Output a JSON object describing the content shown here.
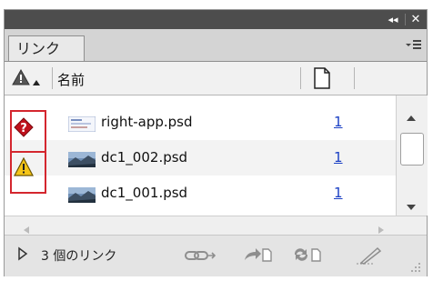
{
  "panel": {
    "tab_label": "リンク",
    "column_name_label": "名前",
    "status_text": "3 個のリンク"
  },
  "links": [
    {
      "name": "right-app.psd",
      "page": "1",
      "status": "missing",
      "thumb": "document-thumb"
    },
    {
      "name": "dc1_002.psd",
      "page": "1",
      "status": "modified",
      "thumb": "landscape-thumb"
    },
    {
      "name": "dc1_001.psd",
      "page": "1",
      "status": "ok",
      "thumb": "landscape-thumb"
    }
  ],
  "colors": {
    "titlebar": "#4d4d4d",
    "highlight_box": "#d4262e",
    "missing_icon": "#c0121d",
    "warning_icon": "#f5c518",
    "page_link": "#1a3fc4"
  },
  "icons": [
    "collapse-icon",
    "close-icon",
    "panel-menu-icon",
    "warning-column-icon",
    "sort-arrow-icon",
    "page-icon",
    "missing-link-icon",
    "modified-link-icon",
    "scroll-up-icon",
    "scroll-down-icon",
    "scroll-left-icon",
    "scroll-right-icon",
    "expand-triangle-icon",
    "relink-icon",
    "goto-link-icon",
    "update-link-icon",
    "edit-original-icon",
    "resize-grip-icon"
  ]
}
